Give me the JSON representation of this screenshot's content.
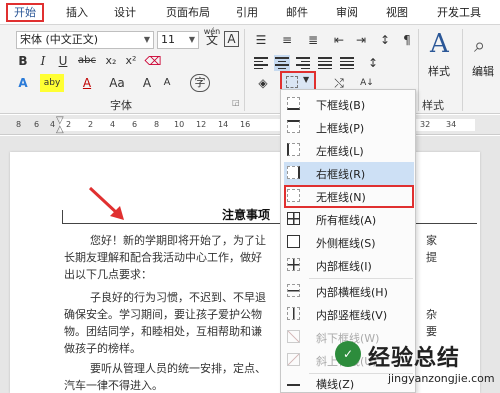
{
  "tabs": [
    {
      "label": "开始",
      "active": true
    },
    {
      "label": "插入"
    },
    {
      "label": "设计"
    },
    {
      "label": "页面布局"
    },
    {
      "label": "引用"
    },
    {
      "label": "邮件"
    },
    {
      "label": "审阅"
    },
    {
      "label": "视图"
    },
    {
      "label": "开发工具"
    }
  ],
  "font": {
    "name": "宋体 (中文正文)",
    "size": "11",
    "bold": "B",
    "italic": "I",
    "underline": "U",
    "strike": "abc",
    "subscript": "x₂",
    "superscript": "x²",
    "grow": "A",
    "shrink": "A",
    "case": "Aa",
    "color_a": "A",
    "highlight": "aby",
    "group_label": "字体",
    "phonetic_top": "wén",
    "phonetic_char": "文",
    "char_border": "A"
  },
  "styles": {
    "label": "样式",
    "icon_letter": "A"
  },
  "editing": {
    "label": "编辑"
  },
  "ruler_numbers": [
    "8",
    "6",
    "4",
    "2",
    "2",
    "4",
    "6",
    "8",
    "10",
    "12",
    "14",
    "16",
    "32",
    "34"
  ],
  "document": {
    "title": "注意事项",
    "lines": [
      "您好！新的学期即将开始了，为了让",
      "长期友理解和配合我活动中心工作，做好",
      "出以下几点要求：",
      "子良好的行为习惯，不迟到、不早退",
      "确保安全。学习期间，要让孩子爱护公物",
      "物。团结同学，和睦相处，互相帮助和谦",
      "做孩子的榜样。",
      "要听从管理人员的统一安排，定点、",
      "汽车一律不得进入。"
    ],
    "right_fragments": [
      "家",
      "提",
      "杂",
      "要"
    ]
  },
  "menu": {
    "items": [
      {
        "label": "下框线(B)",
        "state": "normal"
      },
      {
        "label": "上框线(P)",
        "state": "normal"
      },
      {
        "label": "左框线(L)",
        "state": "normal"
      },
      {
        "label": "右框线(R)",
        "state": "highlighted"
      },
      {
        "label": "无框线(N)",
        "state": "boxed"
      },
      {
        "label": "所有框线(A)",
        "state": "normal"
      },
      {
        "label": "外侧框线(S)",
        "state": "normal"
      },
      {
        "label": "内部框线(I)",
        "state": "normal"
      },
      {
        "label": "内部横框线(H)",
        "state": "normal"
      },
      {
        "label": "内部竖框线(V)",
        "state": "normal"
      },
      {
        "label": "斜下框线(W)",
        "state": "disabled"
      },
      {
        "label": "斜上框线(U)",
        "state": "disabled"
      },
      {
        "label": "横线(Z)",
        "state": "normal"
      }
    ]
  },
  "watermark": {
    "cn": "经验总结",
    "url": "jingyanzongjie.com",
    "logo": "✓"
  },
  "colors": {
    "accent_red": "#e03030",
    "tab_active": "#2b5797",
    "highlight": "#cde0f5"
  }
}
